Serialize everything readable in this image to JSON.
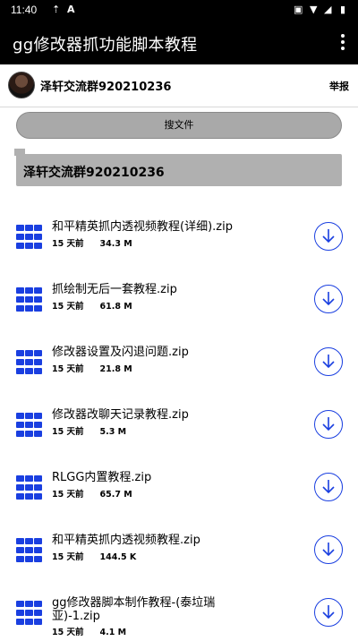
{
  "status_bar": {
    "time": "11:40",
    "icons": [
      "upload-icon",
      "font-icon",
      "lock-icon",
      "wifi-icon",
      "signal-icon",
      "battery-icon"
    ]
  },
  "app_bar": {
    "title": "gg修改器抓功能脚本教程",
    "menu_icon": "more-vert-icon"
  },
  "user_bar": {
    "username": "泽轩交流群920210236",
    "report_label": "举报"
  },
  "search": {
    "button_label": "搜文件"
  },
  "group": {
    "label": "泽轩交流群920210236"
  },
  "files": [
    {
      "name": "和平精英抓内透视频教程(详细).zip",
      "time": "15 天前",
      "size": "34.3 M"
    },
    {
      "name": "抓绘制无后一套教程.zip",
      "time": "15 天前",
      "size": "61.8 M"
    },
    {
      "name": "修改器设置及闪退问题.zip",
      "time": "15 天前",
      "size": "21.8 M"
    },
    {
      "name": "修改器改聊天记录教程.zip",
      "time": "15 天前",
      "size": "5.3 M"
    },
    {
      "name": "RLGG内置教程.zip",
      "time": "15 天前",
      "size": "65.7 M"
    },
    {
      "name": "和平精英抓内透视频教程.zip",
      "time": "15 天前",
      "size": "144.5 K"
    },
    {
      "name": "gg修改器脚本制作教程-(泰垃瑞亚)-1.zip",
      "time": "15 天前",
      "size": "4.1 M"
    }
  ],
  "colors": {
    "bar_bg": "#000000",
    "accent_blue": "#1a3fe0",
    "button_gray": "#a9a9a9"
  }
}
